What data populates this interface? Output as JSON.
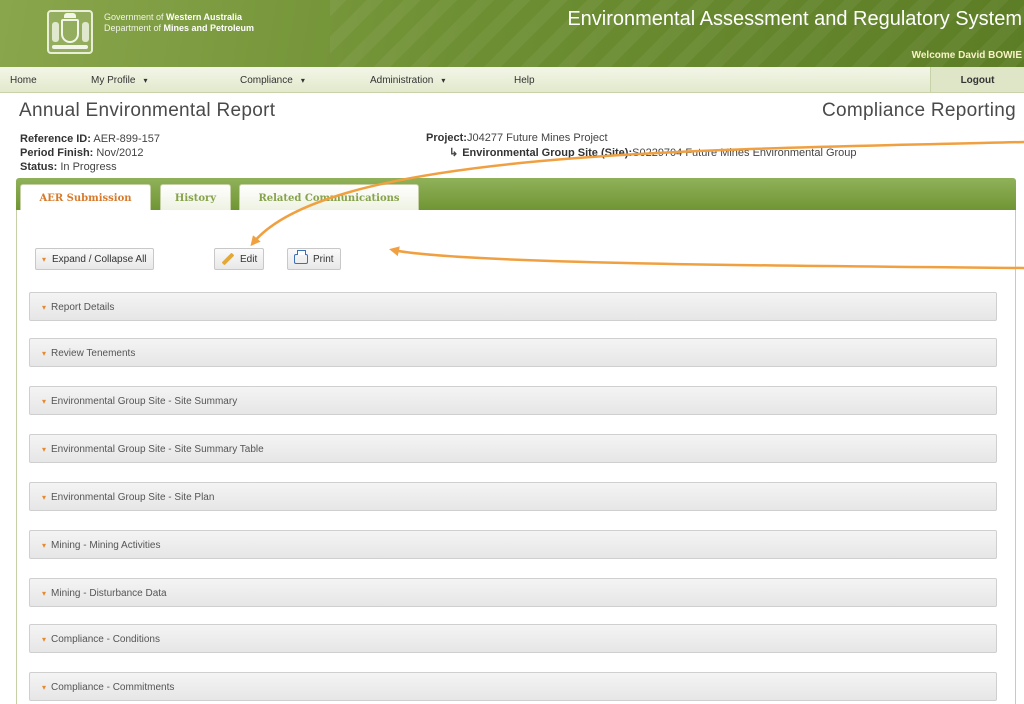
{
  "header": {
    "gov_line1_prefix": "Government of ",
    "gov_line1_bold": "Western Australia",
    "gov_line2_prefix": "Department of ",
    "gov_line2_bold": "Mines and Petroleum",
    "system_title": "Environmental Assessment and Regulatory System",
    "welcome": "Welcome David BOWIE",
    "logo_icon": "wa-crest-icon"
  },
  "menu": {
    "items": [
      {
        "label": "Home",
        "has_dropdown": false
      },
      {
        "label": "My Profile",
        "has_dropdown": true
      },
      {
        "label": "Compliance",
        "has_dropdown": true
      },
      {
        "label": "Administration",
        "has_dropdown": true
      },
      {
        "label": "Help",
        "has_dropdown": false
      }
    ],
    "caret": "▾",
    "logout": "Logout"
  },
  "page": {
    "title": "Annual Environmental Report",
    "section": "Compliance Reporting"
  },
  "meta": {
    "reference_label": "Reference ID:",
    "reference_value": " AER-899-157",
    "period_label": "Period Finish:",
    "period_value": " Nov/2012",
    "status_label": "Status:",
    "status_value": " In Progress",
    "project_label": "Project:",
    "project_value": "J04277 Future Mines Project",
    "site_arrow": "↳",
    "site_label": "Environmental Group Site (Site):",
    "site_value": "S0229704 Future Mines Environmental Group"
  },
  "tabs": [
    {
      "label": "AER Submission",
      "active": true
    },
    {
      "label": "History",
      "active": false
    },
    {
      "label": "Related Communications",
      "active": false
    }
  ],
  "toolbar": {
    "expand_label": "Expand / Collapse All",
    "edit_label": "Edit",
    "print_label": "Print",
    "caret": "▾"
  },
  "sections": [
    "Report Details",
    "Review Tenements",
    "Environmental Group Site - Site Summary",
    "Environmental Group Site - Site Summary Table",
    "Environmental Group Site - Site Plan",
    "Mining - Mining Activities",
    "Mining - Disturbance Data",
    "Compliance - Conditions",
    "Compliance - Commitments"
  ],
  "colors": {
    "brand_green": "#6e8f33",
    "tab_active_text": "#d77a2b",
    "accent_orange": "#e8892f",
    "annotation_arrow": "#f0a040"
  }
}
